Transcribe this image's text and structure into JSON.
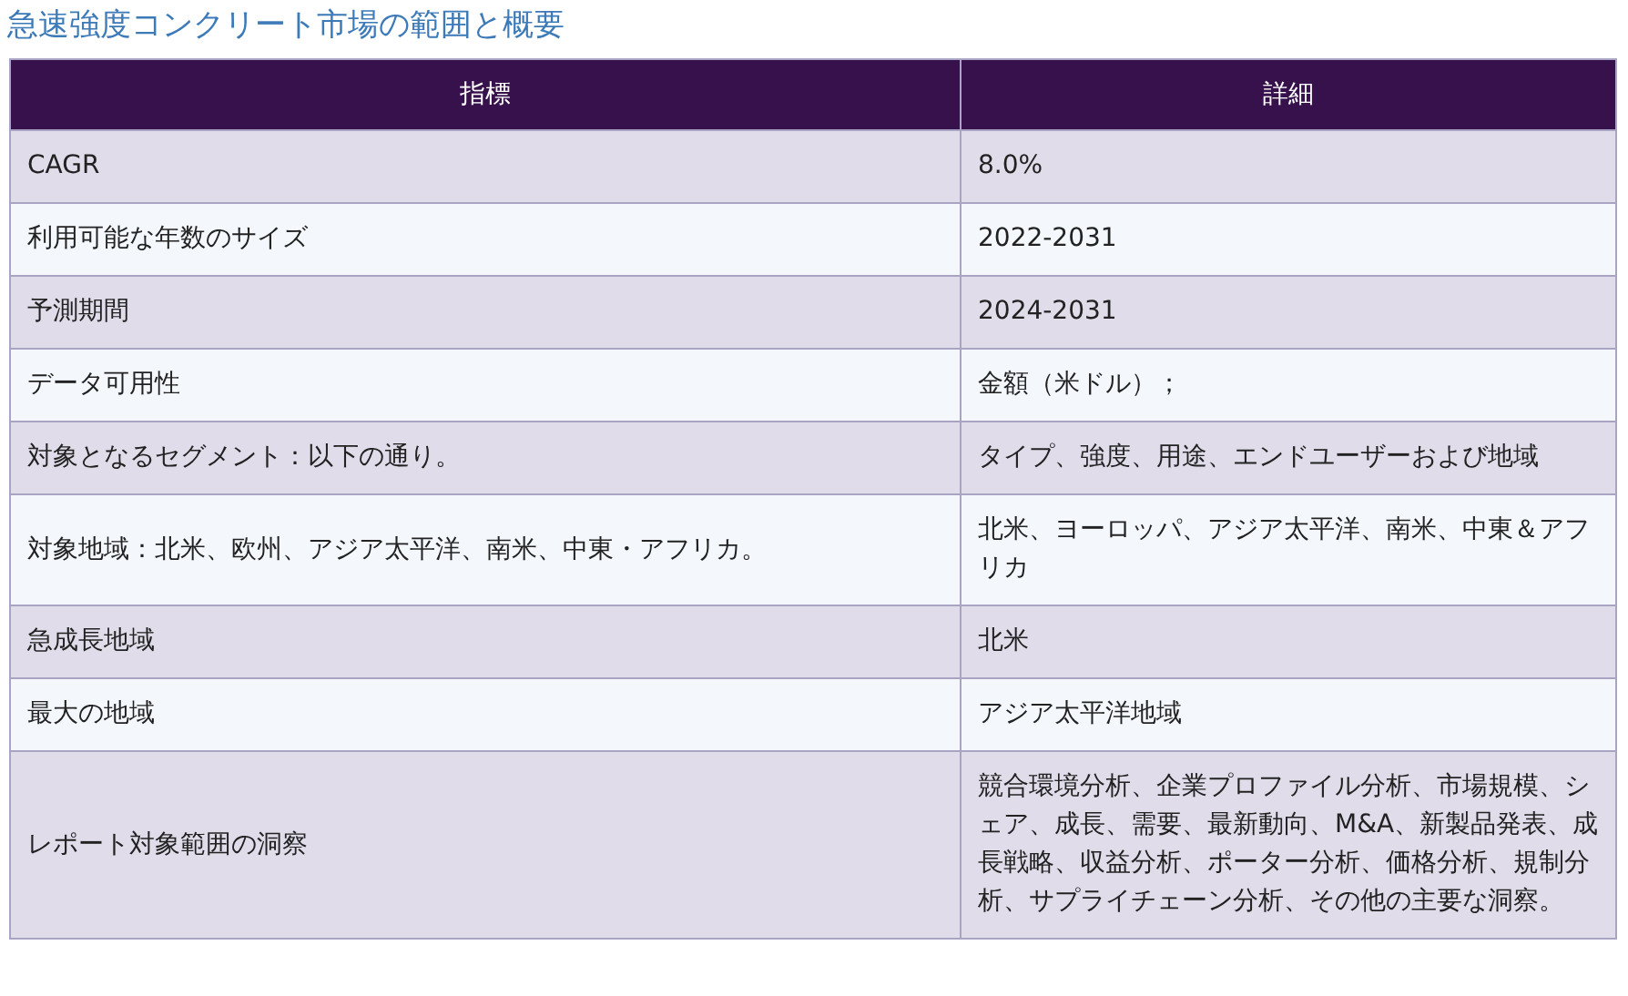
{
  "title": "急速強度コンクリート市場の範囲と概要",
  "table": {
    "columns": [
      "指標",
      "詳細"
    ],
    "rows": [
      [
        "CAGR",
        "8.0%"
      ],
      [
        "利用可能な年数のサイズ",
        "2022-2031"
      ],
      [
        "予測期間",
        "2024-2031"
      ],
      [
        "データ可用性",
        "金額（米ドル）；"
      ],
      [
        "対象となるセグメント：以下の通り。",
        "タイプ、強度、用途、エンドユーザーおよび地域"
      ],
      [
        "対象地域：北米、欧州、アジア太平洋、南米、中東・アフリカ。",
        "北米、ヨーロッパ、アジア太平洋、南米、中東＆アフリカ"
      ],
      [
        "急成長地域",
        "北米"
      ],
      [
        "最大の地域",
        "アジア太平洋地域"
      ],
      [
        "レポート対象範囲の洞察",
        "競合環境分析、企業プロファイル分析、市場規模、シェア、成長、需要、最新動向、M&A、新製品発表、成長戦略、収益分析、ポーター分析、価格分析、規制分析、サプライチェーン分析、その他の主要な洞察。"
      ]
    ]
  }
}
